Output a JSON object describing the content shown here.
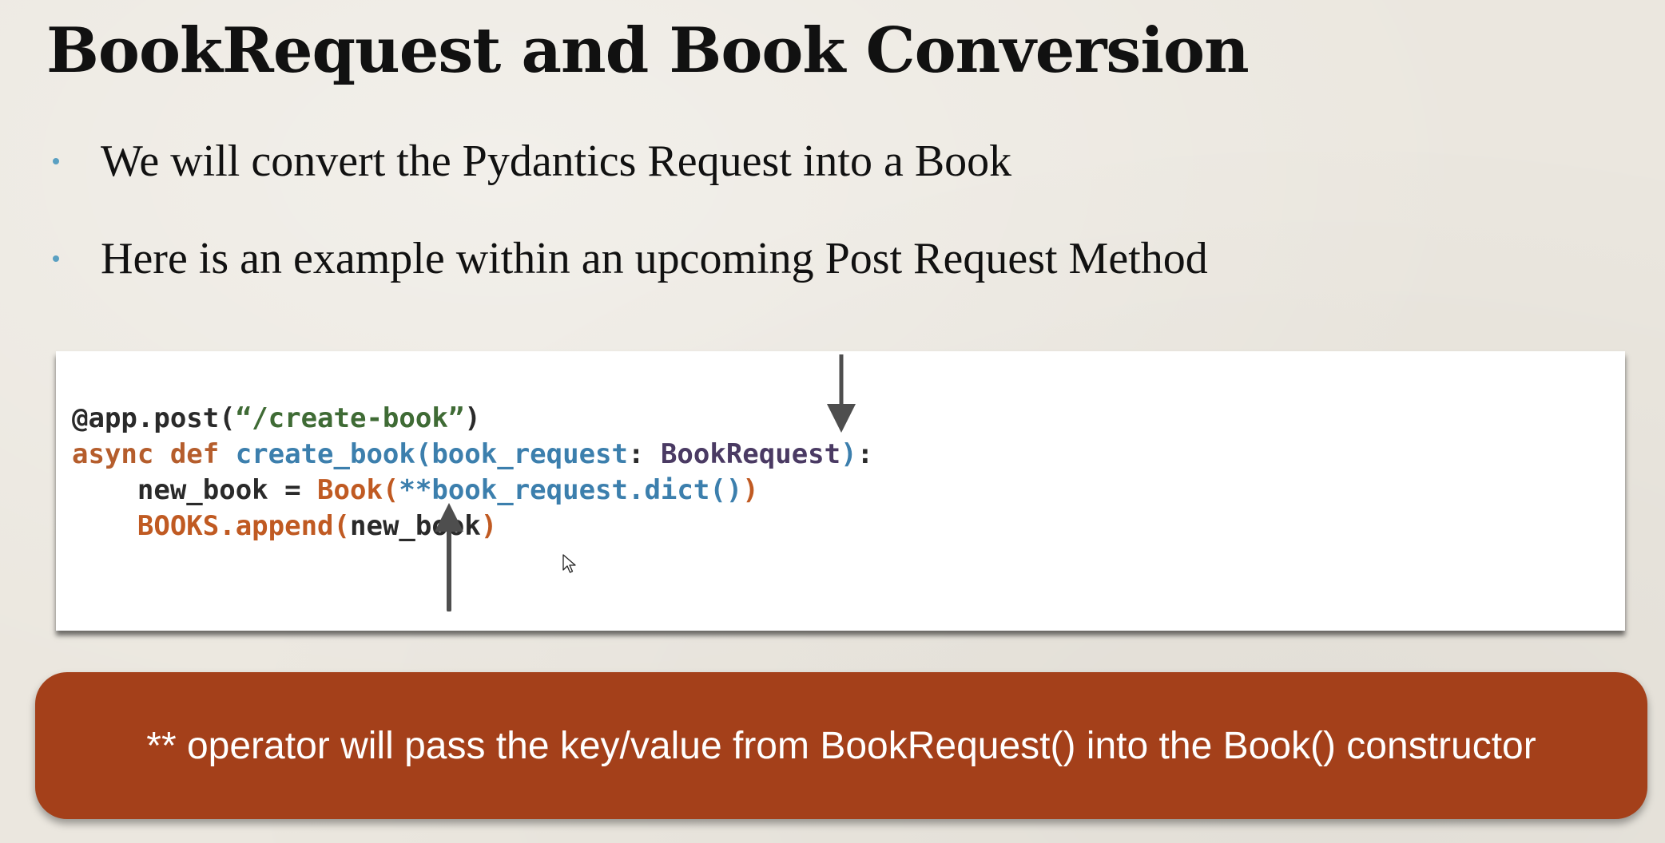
{
  "slide": {
    "title": "BookRequest and Book Conversion",
    "bullets": [
      {
        "text": "We will convert the Pydantics Request into a Book"
      },
      {
        "text": "Here is an example within an upcoming Post Request Method"
      }
    ]
  },
  "code": {
    "line1": {
      "decorator": "@app.post(",
      "route": "“/create-book”",
      "close": ")"
    },
    "line2": {
      "keywords": "async def ",
      "func": "create_book(book_request",
      "colon": ": ",
      "type": "BookRequest",
      "close": ")",
      "end": ":"
    },
    "line3": {
      "indent_var": "    new_book = ",
      "cls": "Book(",
      "unpack": "**book_request.dict()",
      "close": ")"
    },
    "line4": {
      "indent": "    ",
      "call": "BOOKS.append(",
      "arg": "new_book",
      "close": ")"
    }
  },
  "callout": {
    "text": "** operator will pass the key/value from BookRequest() into the Book() constructor",
    "background": "#a4401a"
  },
  "icons": {
    "arrow_down": "arrow-down-icon",
    "arrow_up": "arrow-up-icon",
    "cursor": "mouse-cursor-icon"
  }
}
